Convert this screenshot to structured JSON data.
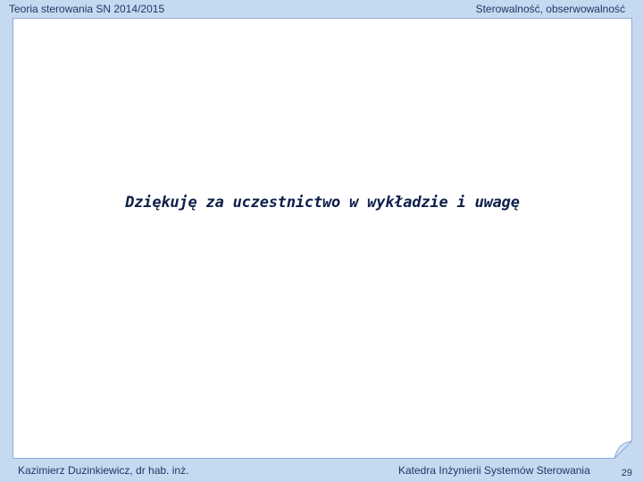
{
  "header": {
    "course": "Teoria sterowania SN 2014/2015",
    "topic": "Sterowalność, obserwowalność"
  },
  "slide": {
    "message": "Dziękuję za uczestnictwo w wykładzie i uwagę"
  },
  "footer": {
    "author": "Kazimierz Duzinkiewicz, dr hab. inż.",
    "department": "Katedra Inżynierii Systemów Sterowania",
    "page_number": "29"
  },
  "colors": {
    "background": "#c5d9f1",
    "page": "#ffffff",
    "text": "#1f3864"
  }
}
